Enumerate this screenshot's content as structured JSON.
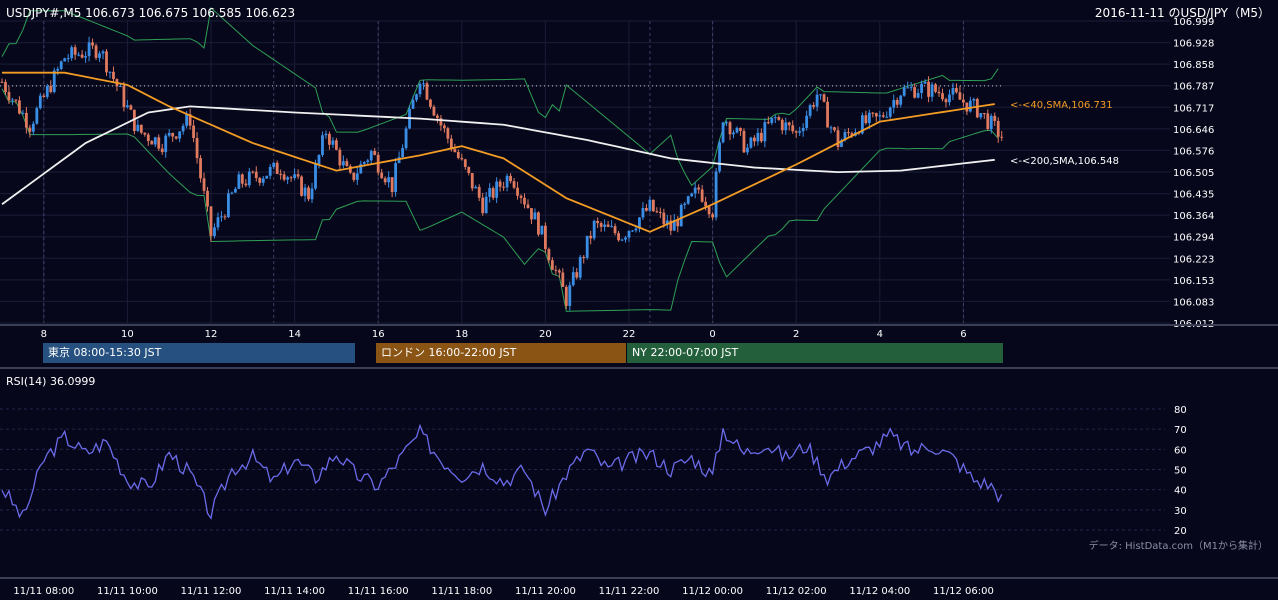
{
  "header": {
    "symbol_ohlc": "USDJPY#,M5 106.673 106.675 106.585 106.623",
    "title": "2016-11-11 のUSD/JPY（M5）"
  },
  "sessions": [
    {
      "label": "東京 08:00-15:30 JST",
      "color": "#25507f"
    },
    {
      "label": "ロンドン 16:00-22:00 JST",
      "color": "#8a5414"
    },
    {
      "label": "NY 22:00-07:00 JST",
      "color": "#245f3c"
    }
  ],
  "price_axis_labels": [
    "106.999",
    "106.928",
    "106.858",
    "106.787",
    "106.717",
    "106.646",
    "106.576",
    "106.505",
    "106.435",
    "106.364",
    "106.294",
    "106.223",
    "106.153",
    "106.083",
    "106.012"
  ],
  "hour_axis_labels": [
    "8",
    "10",
    "12",
    "14",
    "16",
    "18",
    "20",
    "22",
    "0",
    "2",
    "4",
    "6"
  ],
  "sma40_label": "<-<40,SMA,106.731",
  "sma200_label": "<-<200,SMA,106.548",
  "rsi_label": "RSI(14) 36.0999",
  "rsi_axis_labels": [
    "80",
    "70",
    "60",
    "50",
    "40",
    "30",
    "20"
  ],
  "source_note": "データ: HistData.com（M1から集計）",
  "time_labels": [
    "11/11 08:00",
    "11/11 10:00",
    "11/11 12:00",
    "11/11 14:00",
    "11/11 16:00",
    "11/11 18:00",
    "11/11 20:00",
    "11/11 22:00",
    "11/12 00:00",
    "11/12 02:00",
    "11/12 04:00",
    "11/12 06:00"
  ],
  "colors": {
    "up": "#3a8ee6",
    "down": "#e07a5f",
    "sma40": "#f39c24",
    "sma200": "#f0f0f0",
    "bands": "#2ea055",
    "rsi": "#6b6bea"
  },
  "chart_data": [
    {
      "type": "candlestick",
      "title": "2016-11-11 のUSD/JPY（M5）",
      "ylim": [
        106.012,
        106.999
      ],
      "x_range_hours": [
        "11/11 07:00",
        "11/12 06:55"
      ],
      "key_points": [
        {
          "t": "11/11 07:00",
          "close": 106.8
        },
        {
          "t": "11/11 07:40",
          "close": 106.66
        },
        {
          "t": "11/11 08:30",
          "close": 106.88
        },
        {
          "t": "11/11 09:20",
          "close": 106.91
        },
        {
          "t": "11/11 10:15",
          "close": 106.64
        },
        {
          "t": "11/11 10:50",
          "close": 106.6
        },
        {
          "t": "11/11 11:30",
          "close": 106.68
        },
        {
          "t": "11/11 12:00",
          "close": 106.3
        },
        {
          "t": "11/11 12:40",
          "close": 106.47
        },
        {
          "t": "11/11 13:40",
          "close": 106.52
        },
        {
          "t": "11/11 14:20",
          "close": 106.43
        },
        {
          "t": "11/11 14:45",
          "close": 106.64
        },
        {
          "t": "11/11 15:20",
          "close": 106.48
        },
        {
          "t": "11/11 15:50",
          "close": 106.57
        },
        {
          "t": "11/11 16:20",
          "close": 106.46
        },
        {
          "t": "11/11 17:00",
          "close": 106.82
        },
        {
          "t": "11/11 17:30",
          "close": 106.66
        },
        {
          "t": "11/11 18:00",
          "close": 106.53
        },
        {
          "t": "11/11 18:30",
          "close": 106.4
        },
        {
          "t": "11/11 19:10",
          "close": 106.5
        },
        {
          "t": "11/11 19:50",
          "close": 106.33
        },
        {
          "t": "11/11 20:30",
          "close": 106.09
        },
        {
          "t": "11/11 21:10",
          "close": 106.33
        },
        {
          "t": "11/11 21:50",
          "close": 106.3
        },
        {
          "t": "11/11 22:30",
          "close": 106.39
        },
        {
          "t": "11/11 23:00",
          "close": 106.32
        },
        {
          "t": "11/11 23:40",
          "close": 106.45
        },
        {
          "t": "11/12 00:00",
          "close": 106.38
        },
        {
          "t": "11/12 00:15",
          "close": 106.69
        },
        {
          "t": "11/12 00:50",
          "close": 106.58
        },
        {
          "t": "11/12 01:30",
          "close": 106.68
        },
        {
          "t": "11/12 02:00",
          "close": 106.63
        },
        {
          "t": "11/12 02:30",
          "close": 106.76
        },
        {
          "t": "11/12 03:00",
          "close": 106.6
        },
        {
          "t": "11/12 03:30",
          "close": 106.66
        },
        {
          "t": "11/12 04:00",
          "close": 106.68
        },
        {
          "t": "11/12 04:30",
          "close": 106.77
        },
        {
          "t": "11/12 05:00",
          "close": 106.78
        },
        {
          "t": "11/12 05:40",
          "close": 106.76
        },
        {
          "t": "11/12 06:20",
          "close": 106.71
        },
        {
          "t": "11/12 06:55",
          "close": 106.623
        }
      ],
      "sma200_points": [
        {
          "t": "11/11 07:00",
          "v": 106.4
        },
        {
          "t": "11/11 09:00",
          "v": 106.6
        },
        {
          "t": "11/11 10:30",
          "v": 106.7
        },
        {
          "t": "11/11 11:30",
          "v": 106.72
        },
        {
          "t": "11/11 14:00",
          "v": 106.7
        },
        {
          "t": "11/11 17:00",
          "v": 106.68
        },
        {
          "t": "11/11 19:00",
          "v": 106.66
        },
        {
          "t": "11/11 21:00",
          "v": 106.61
        },
        {
          "t": "11/11 23:00",
          "v": 106.55
        },
        {
          "t": "11/12 01:00",
          "v": 106.52
        },
        {
          "t": "11/12 03:00",
          "v": 106.505
        },
        {
          "t": "11/12 04:30",
          "v": 106.51
        },
        {
          "t": "11/12 06:55",
          "v": 106.548
        }
      ],
      "sma40_points": [
        {
          "t": "11/11 07:00",
          "v": 106.83
        },
        {
          "t": "11/11 08:30",
          "v": 106.83
        },
        {
          "t": "11/11 10:00",
          "v": 106.79
        },
        {
          "t": "11/11 11:00",
          "v": 106.72
        },
        {
          "t": "11/11 13:00",
          "v": 106.6
        },
        {
          "t": "11/11 15:00",
          "v": 106.51
        },
        {
          "t": "11/11 17:00",
          "v": 106.56
        },
        {
          "t": "11/11 18:00",
          "v": 106.59
        },
        {
          "t": "11/11 19:00",
          "v": 106.55
        },
        {
          "t": "11/11 20:30",
          "v": 106.42
        },
        {
          "t": "11/11 22:30",
          "v": 106.31
        },
        {
          "t": "11/12 00:00",
          "v": 106.4
        },
        {
          "t": "11/12 02:00",
          "v": 106.53
        },
        {
          "t": "11/12 04:00",
          "v": 106.67
        },
        {
          "t": "11/12 06:55",
          "v": 106.731
        }
      ]
    },
    {
      "type": "line",
      "title": "RSI(14) 36.0999",
      "ylim": [
        20,
        80
      ],
      "points": [
        {
          "t": "11/11 07:00",
          "v": 41
        },
        {
          "t": "11/11 07:30",
          "v": 26
        },
        {
          "t": "11/11 08:00",
          "v": 55
        },
        {
          "t": "11/11 08:30",
          "v": 66
        },
        {
          "t": "11/11 09:00",
          "v": 58
        },
        {
          "t": "11/11 09:30",
          "v": 64
        },
        {
          "t": "11/11 10:00",
          "v": 45
        },
        {
          "t": "11/11 10:30",
          "v": 41
        },
        {
          "t": "11/11 11:00",
          "v": 58
        },
        {
          "t": "11/11 11:30",
          "v": 48
        },
        {
          "t": "11/11 12:00",
          "v": 28
        },
        {
          "t": "11/11 12:30",
          "v": 50
        },
        {
          "t": "11/11 13:00",
          "v": 56
        },
        {
          "t": "11/11 13:30",
          "v": 44
        },
        {
          "t": "11/11 14:00",
          "v": 55
        },
        {
          "t": "11/11 14:30",
          "v": 46
        },
        {
          "t": "11/11 15:00",
          "v": 58
        },
        {
          "t": "11/11 15:30",
          "v": 47
        },
        {
          "t": "11/11 16:00",
          "v": 42
        },
        {
          "t": "11/11 16:30",
          "v": 55
        },
        {
          "t": "11/11 17:00",
          "v": 68
        },
        {
          "t": "11/11 17:30",
          "v": 55
        },
        {
          "t": "11/11 18:00",
          "v": 47
        },
        {
          "t": "11/11 18:30",
          "v": 52
        },
        {
          "t": "11/11 19:00",
          "v": 44
        },
        {
          "t": "11/11 19:30",
          "v": 50
        },
        {
          "t": "11/11 20:00",
          "v": 30
        },
        {
          "t": "11/11 20:30",
          "v": 48
        },
        {
          "t": "11/11 21:00",
          "v": 60
        },
        {
          "t": "11/11 21:30",
          "v": 50
        },
        {
          "t": "11/11 22:00",
          "v": 55
        },
        {
          "t": "11/11 22:30",
          "v": 58
        },
        {
          "t": "11/11 23:00",
          "v": 50
        },
        {
          "t": "11/11 23:30",
          "v": 56
        },
        {
          "t": "11/12 00:00",
          "v": 47
        },
        {
          "t": "11/12 00:15",
          "v": 70
        },
        {
          "t": "11/12 00:45",
          "v": 58
        },
        {
          "t": "11/12 01:15",
          "v": 63
        },
        {
          "t": "11/12 01:45",
          "v": 56
        },
        {
          "t": "11/12 02:15",
          "v": 62
        },
        {
          "t": "11/12 02:45",
          "v": 46
        },
        {
          "t": "11/12 03:15",
          "v": 55
        },
        {
          "t": "11/12 03:45",
          "v": 60
        },
        {
          "t": "11/12 04:15",
          "v": 67
        },
        {
          "t": "11/12 04:45",
          "v": 59
        },
        {
          "t": "11/12 05:15",
          "v": 62
        },
        {
          "t": "11/12 05:45",
          "v": 56
        },
        {
          "t": "11/12 06:15",
          "v": 45
        },
        {
          "t": "11/12 06:40",
          "v": 42
        },
        {
          "t": "11/12 06:55",
          "v": 36
        }
      ]
    }
  ]
}
